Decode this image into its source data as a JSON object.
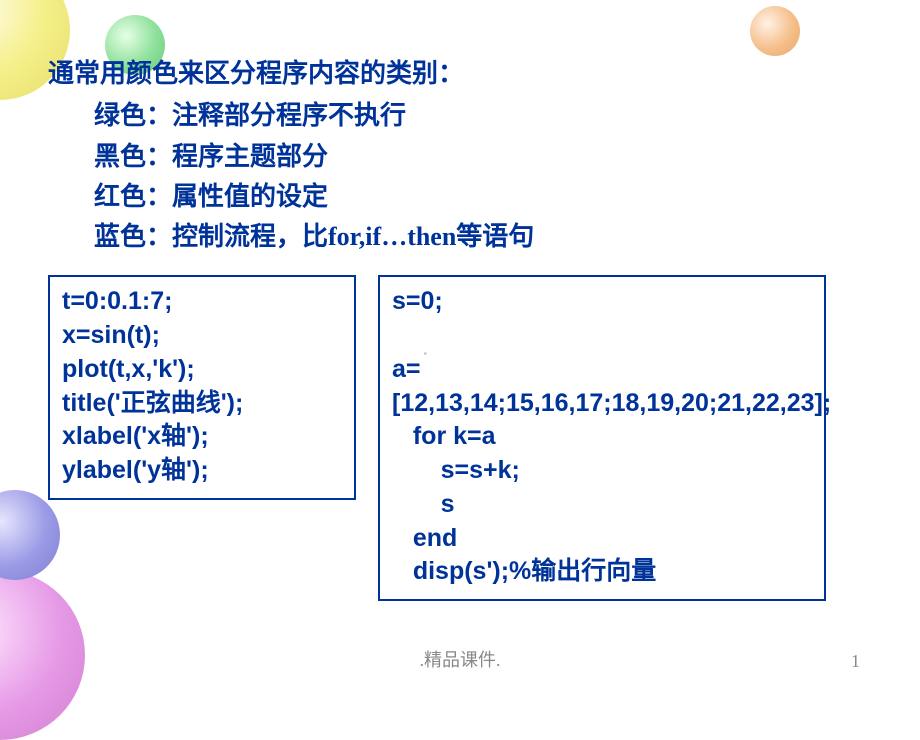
{
  "heading": "通常用颜色来区分程序内容的类别：",
  "lines": {
    "green": "绿色：注释部分程序不执行",
    "black": "黑色：程序主题部分",
    "red": "红色：属性值的设定",
    "blue": "蓝色：控制流程，比for,if…then等语句"
  },
  "code_left": "t=0:0.1:7;\nx=sin(t);\nplot(t,x,'k');\ntitle('正弦曲线');\nxlabel('x轴');\nylabel('y轴');",
  "code_right": "s=0;\n\na=[12,13,14;15,16,17;18,19,20;21,22,23];\n   for k=a\n       s=s+k;\n       s\n   end\n   disp(s');%输出行向量",
  "footer": ".精品课件.",
  "page_number": "1"
}
